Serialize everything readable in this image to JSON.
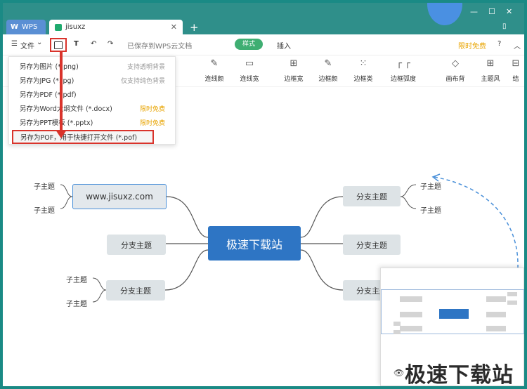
{
  "tabs": [
    {
      "label": "WPS",
      "logo": "W"
    },
    {
      "label": "jisuxz"
    }
  ],
  "toolbar": {
    "file_label": "文件",
    "saved_text": "已保存到WPS云文档",
    "tab_style": "样式",
    "tab_insert": "插入",
    "free_label": "限时免费",
    "help_label": "?"
  },
  "ribbon": [
    {
      "label": "连线颜",
      "icon": "line-color-icon"
    },
    {
      "label": "连线宽",
      "icon": "line-width-icon"
    },
    {
      "label": "边框宽",
      "icon": "border-width-icon"
    },
    {
      "label": "边框颜",
      "icon": "border-color-icon"
    },
    {
      "label": "边框类",
      "icon": "border-type-icon"
    },
    {
      "label": "边框弧度",
      "icon": "border-radius-icon"
    },
    {
      "label": "画布背",
      "icon": "canvas-bg-icon"
    },
    {
      "label": "主题风",
      "icon": "theme-style-icon"
    },
    {
      "label": "结",
      "icon": "structure-icon"
    }
  ],
  "menu": [
    {
      "label": "另存为图片 (*.png)",
      "note": "支持透明背景",
      "free": false
    },
    {
      "label": "另存为JPG (*.jpg)",
      "note": "仅支持纯色背景",
      "free": false
    },
    {
      "label": "另存为PDF (*.pdf)",
      "note": "",
      "free": false
    },
    {
      "label": "另存为Word大纲文件 (*.docx)",
      "note": "限时免费",
      "free": true
    },
    {
      "label": "另存为PPT模板 (*.pptx)",
      "note": "限时免费",
      "free": true
    },
    {
      "label": "另存为POF，用于快捷打开文件 (*.pof)",
      "note": "",
      "free": false
    }
  ],
  "mindmap": {
    "center": "极速下载站",
    "left_top": "www.jisuxz.com",
    "left_mid": "分支主题",
    "left_bottom": "分支主题",
    "right_top": "分支主题",
    "right_mid": "分支主题",
    "right_bottom": "分支主题",
    "sub_topic": "子主题"
  },
  "watermark": "极速下载站",
  "colors": {
    "accent_green": "#3fae72",
    "title_teal": "#2f8f8a",
    "center_blue": "#2e75c4",
    "highlight_red": "#d9332b",
    "free_orange": "#e8a400"
  }
}
